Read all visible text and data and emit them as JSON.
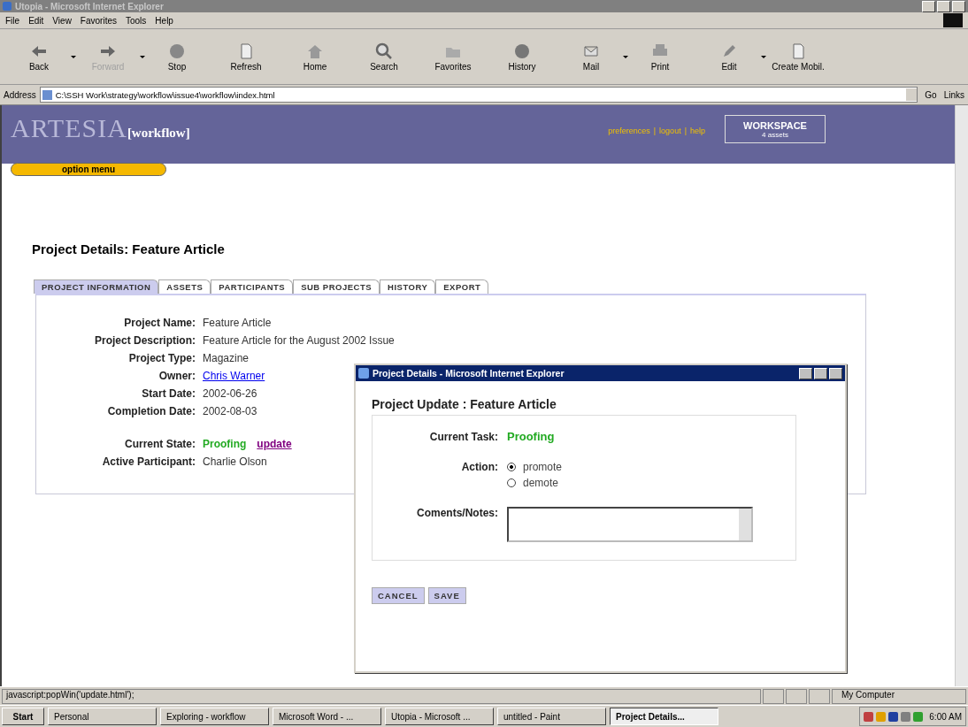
{
  "window": {
    "title": "Utopia - Microsoft Internet Explorer"
  },
  "menu": [
    "File",
    "Edit",
    "View",
    "Favorites",
    "Tools",
    "Help"
  ],
  "toolbar": [
    {
      "label": "Back",
      "disabled": false,
      "dropdown": true
    },
    {
      "label": "Forward",
      "disabled": true,
      "dropdown": true
    },
    {
      "label": "Stop",
      "disabled": false,
      "dropdown": false
    },
    {
      "label": "Refresh",
      "disabled": false,
      "dropdown": false
    },
    {
      "label": "Home",
      "disabled": false,
      "dropdown": false
    },
    {
      "label": "Search",
      "disabled": false,
      "dropdown": false
    },
    {
      "label": "Favorites",
      "disabled": false,
      "dropdown": false
    },
    {
      "label": "History",
      "disabled": false,
      "dropdown": false
    },
    {
      "label": "Mail",
      "disabled": false,
      "dropdown": true
    },
    {
      "label": "Print",
      "disabled": false,
      "dropdown": false
    },
    {
      "label": "Edit",
      "disabled": false,
      "dropdown": true
    },
    {
      "label": "Create Mobil.",
      "disabled": false,
      "dropdown": false
    }
  ],
  "address": {
    "label": "Address",
    "url": "C:\\SSH Work\\strategy\\workflow\\issue4\\workflow\\index.html",
    "go": "Go",
    "links": "Links"
  },
  "banner": {
    "logo": "ARTESIA",
    "logo_sub": "[workflow]",
    "links": [
      "preferences",
      "logout",
      "help"
    ],
    "separator": "|",
    "workspace": {
      "title": "WORKSPACE",
      "sub": "4 assets"
    },
    "option_menu": "option menu"
  },
  "page": {
    "title": "Project Details: Feature Article",
    "tabs": [
      {
        "label": "PROJECT INFORMATION",
        "selected": true
      },
      {
        "label": "ASSETS",
        "selected": false
      },
      {
        "label": "PARTICIPANTS",
        "selected": false
      },
      {
        "label": "SUB PROJECTS",
        "selected": false
      },
      {
        "label": "HISTORY",
        "selected": false
      },
      {
        "label": "EXPORT",
        "selected": false
      }
    ],
    "fields": [
      {
        "label": "Project Name:",
        "value": "Feature Article",
        "kind": "text"
      },
      {
        "label": "Project Description:",
        "value": "Feature Article for the August 2002 Issue",
        "kind": "text"
      },
      {
        "label": "Project Type:",
        "value": "Magazine",
        "kind": "text"
      },
      {
        "label": "Owner:",
        "value": "Chris Warner",
        "kind": "link"
      },
      {
        "label": "Start Date:",
        "value": "2002-06-26",
        "kind": "text"
      },
      {
        "label": "Completion Date:",
        "value": "2002-08-03",
        "kind": "text"
      }
    ],
    "state": {
      "label": "Current State:",
      "value": "Proofing",
      "action": "update"
    },
    "participant": {
      "label": "Active Participant:",
      "value": "Charlie Olson"
    }
  },
  "popup": {
    "title": "Project Details - Microsoft Internet Explorer",
    "heading": "Project Update : Feature Article",
    "task_label": "Current Task:",
    "task_value": "Proofing",
    "action_label": "Action:",
    "options": [
      {
        "label": "promote",
        "selected": true
      },
      {
        "label": "demote",
        "selected": false
      }
    ],
    "notes_label": "Coments/Notes:",
    "buttons": [
      "CANCEL",
      "SAVE"
    ]
  },
  "status_bar": {
    "text": "javascript:popWin('update.html');",
    "zone": "My Computer"
  },
  "taskbar": {
    "start": "Start",
    "items": [
      {
        "label": "Personal",
        "selected": false
      },
      {
        "label": "Exploring - workflow",
        "selected": false
      },
      {
        "label": "Microsoft Word - ...",
        "selected": false
      },
      {
        "label": "Utopia - Microsoft ...",
        "selected": false
      },
      {
        "label": "untitled - Paint",
        "selected": false
      },
      {
        "label": "Project Details...",
        "selected": true
      }
    ],
    "clock": "6:00 AM"
  }
}
